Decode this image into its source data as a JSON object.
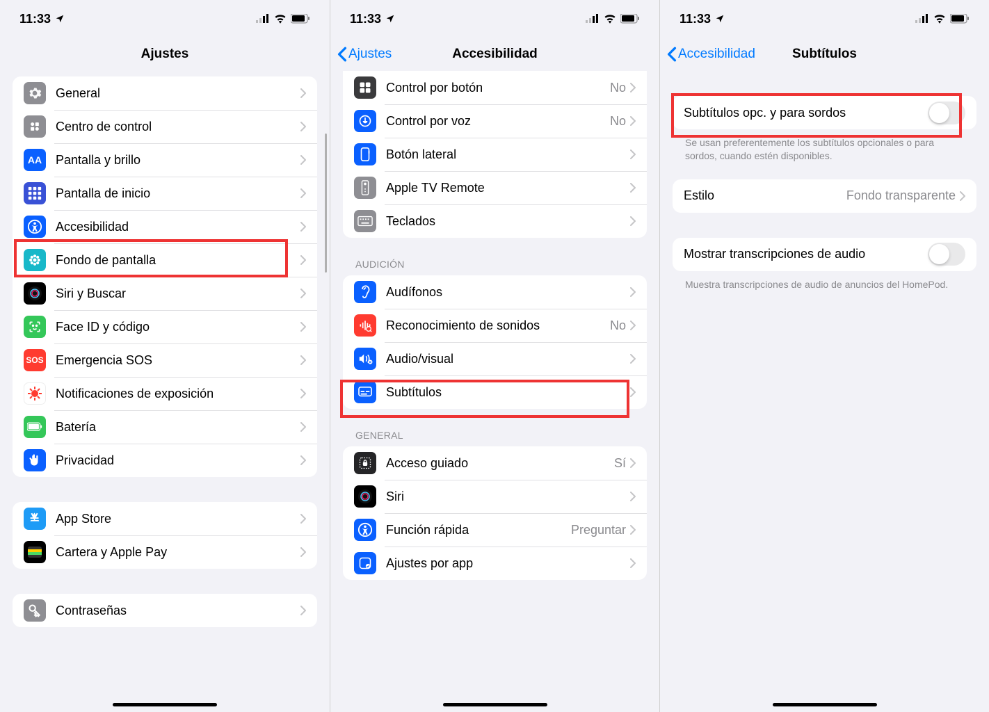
{
  "status": {
    "time": "11:33"
  },
  "screen1": {
    "title": "Ajustes",
    "groups": [
      [
        {
          "icon": "gear",
          "bg": "#8e8e93",
          "label": "General"
        },
        {
          "icon": "cc",
          "bg": "#8e8e93",
          "label": "Centro de control"
        },
        {
          "icon": "aa",
          "bg": "#0a60ff",
          "label": "Pantalla y brillo"
        },
        {
          "icon": "grid",
          "bg": "#3951d6",
          "label": "Pantalla de inicio"
        },
        {
          "icon": "access",
          "bg": "#0a60ff",
          "label": "Accesibilidad"
        },
        {
          "icon": "flower",
          "bg": "#18b8c9",
          "label": "Fondo de pantalla"
        },
        {
          "icon": "siri",
          "bg": "#000",
          "label": "Siri y Buscar"
        },
        {
          "icon": "face",
          "bg": "#34c759",
          "label": "Face ID y código"
        },
        {
          "icon": "sos",
          "bg": "#ff3b30",
          "label": "Emergencia SOS"
        },
        {
          "icon": "covid",
          "bg": "#fff",
          "label": "Notificaciones de exposición"
        },
        {
          "icon": "batt",
          "bg": "#34c759",
          "label": "Batería"
        },
        {
          "icon": "hand",
          "bg": "#0a60ff",
          "label": "Privacidad"
        }
      ],
      [
        {
          "icon": "appstore",
          "bg": "#1e9bf6",
          "label": "App Store"
        },
        {
          "icon": "wallet",
          "bg": "#000",
          "label": "Cartera y Apple Pay"
        }
      ],
      [
        {
          "icon": "key",
          "bg": "#8e8e93",
          "label": "Contraseñas"
        }
      ]
    ]
  },
  "screen2": {
    "back": "Ajustes",
    "title": "Accesibilidad",
    "g0": [
      {
        "icon": "switchctl",
        "bg": "#3a3a3c",
        "label": "Control por botón",
        "value": "No"
      },
      {
        "icon": "voice",
        "bg": "#0a60ff",
        "label": "Control por voz",
        "value": "No"
      },
      {
        "icon": "sidebtn",
        "bg": "#0a60ff",
        "label": "Botón lateral"
      },
      {
        "icon": "remote",
        "bg": "#8e8e93",
        "label": "Apple TV Remote"
      },
      {
        "icon": "kbd",
        "bg": "#8e8e93",
        "label": "Teclados"
      }
    ],
    "hdr1": "AUDICIÓN",
    "g1": [
      {
        "icon": "ear",
        "bg": "#0a60ff",
        "label": "Audífonos"
      },
      {
        "icon": "sound",
        "bg": "#ff3b30",
        "label": "Reconocimiento de sonidos",
        "value": "No"
      },
      {
        "icon": "av",
        "bg": "#0a60ff",
        "label": "Audio/visual"
      },
      {
        "icon": "cc2",
        "bg": "#0a60ff",
        "label": "Subtítulos"
      }
    ],
    "hdr2": "GENERAL",
    "g2": [
      {
        "icon": "lock",
        "bg": "#252527",
        "label": "Acceso guiado",
        "value": "Sí"
      },
      {
        "icon": "siri2",
        "bg": "#000",
        "label": "Siri"
      },
      {
        "icon": "shortcut",
        "bg": "#0a60ff",
        "label": "Función rápida",
        "value": "Preguntar"
      },
      {
        "icon": "perapp",
        "bg": "#0a60ff",
        "label": "Ajustes por app"
      }
    ]
  },
  "screen3": {
    "back": "Accesibilidad",
    "title": "Subtítulos",
    "row1": "Subtítulos opc. y para sordos",
    "foot1": "Se usan preferentemente los subtítulos opcionales o para sordos, cuando estén disponibles.",
    "row2_label": "Estilo",
    "row2_value": "Fondo transparente",
    "row3": "Mostrar transcripciones de audio",
    "foot3": "Muestra transcripciones de audio de anuncios del HomePod."
  }
}
